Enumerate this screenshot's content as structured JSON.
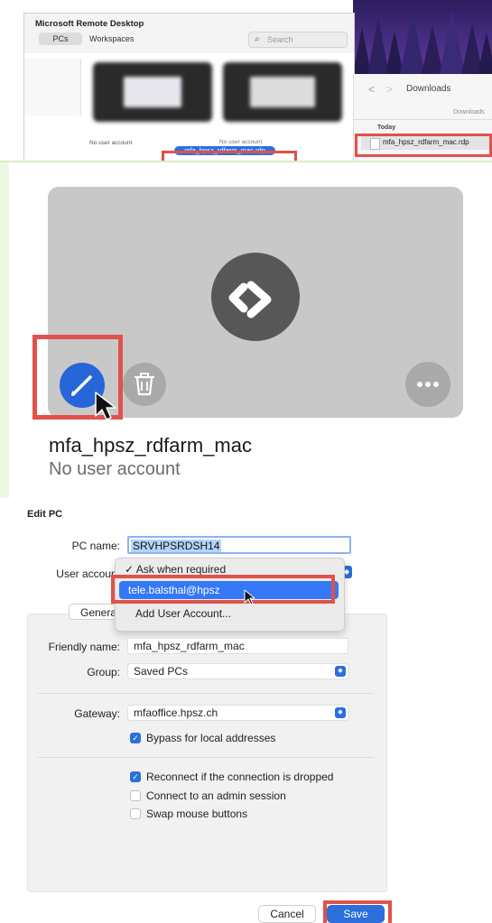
{
  "colors": {
    "accent": "#2c6fdb",
    "highlight": "#e0524a",
    "selection": "#3478f6"
  },
  "rd_window": {
    "title": "Microsoft Remote Desktop",
    "tabs": [
      "PCs",
      "Workspaces"
    ],
    "search_placeholder": "Search",
    "tile_labels": [
      "No user account",
      "No user account"
    ],
    "dragged_file": "mfa_hpsz_rdfarm_mac.rdp"
  },
  "downloads": {
    "title": "Downloads",
    "path": "Downloads",
    "section": "Today",
    "file": "mfa_hpsz_rdfarm_mac.rdp"
  },
  "pc_tile": {
    "name": "mfa_hpsz_rdfarm_mac",
    "user_account": "No user account",
    "icons": [
      "remote-desktop-logo-icon",
      "pencil-icon",
      "trash-icon",
      "more-icon"
    ]
  },
  "edit_pc": {
    "title": "Edit PC",
    "pc_name_label": "PC name:",
    "pc_name_value": "SRVHPSRDSH14",
    "user_account_label": "User account",
    "dropdown_options": [
      "✓ Ask when required",
      "tele.balsthal@hpsz",
      "Add User Account..."
    ],
    "tab_general": "General",
    "friendly_name_label": "Friendly name:",
    "friendly_name_value": "mfa_hpsz_rdfarm_mac",
    "group_label": "Group:",
    "group_value": "Saved PCs",
    "gateway_label": "Gateway:",
    "gateway_value": "mfaoffice.hpsz.ch",
    "checkboxes": [
      {
        "label": "Bypass for local addresses",
        "checked": true
      },
      {
        "label": "Reconnect if the connection is dropped",
        "checked": true
      },
      {
        "label": "Connect to an admin session",
        "checked": false
      },
      {
        "label": "Swap mouse buttons",
        "checked": false
      }
    ],
    "cancel_label": "Cancel",
    "save_label": "Save"
  }
}
